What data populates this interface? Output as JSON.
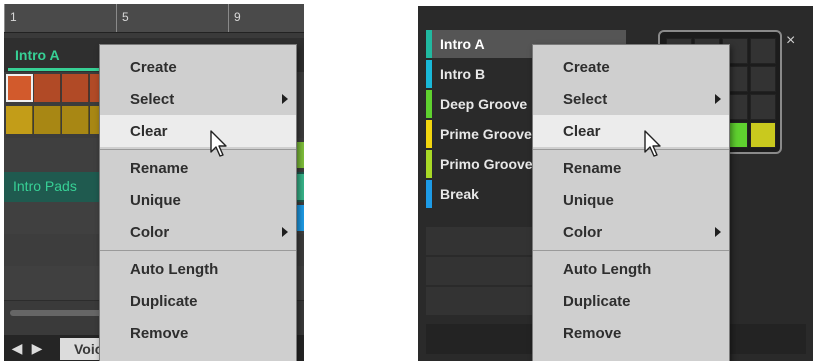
{
  "left": {
    "ruler_bars": [
      "1",
      "5",
      "9"
    ],
    "section_name": "Intro A",
    "pattern_name": "Intro Pads",
    "bottom_tab": "Voice Settings / Engine",
    "menu": {
      "items": [
        "Create",
        "Select",
        "Clear",
        "Rename",
        "Unique",
        "Color",
        "Auto Length",
        "Duplicate",
        "Remove"
      ],
      "submenu_items": [
        "Select",
        "Color"
      ],
      "hovered": "Clear"
    }
  },
  "right": {
    "scenes": [
      {
        "label": "Intro A",
        "color": "#20b9a0"
      },
      {
        "label": "Intro B",
        "color": "#19b8d8"
      },
      {
        "label": "Deep Groove",
        "color": "#5fd12f"
      },
      {
        "label": "Prime Groove",
        "color": "#f2d60f"
      },
      {
        "label": "Primo Groove",
        "color": "#a8d926"
      },
      {
        "label": "Break",
        "color": "#1d9be6"
      }
    ],
    "close_glyph": "×",
    "menu": {
      "items": [
        "Create",
        "Select",
        "Clear",
        "Rename",
        "Unique",
        "Color",
        "Auto Length",
        "Duplicate",
        "Remove"
      ],
      "submenu_items": [
        "Select",
        "Color"
      ],
      "hovered": "Clear"
    }
  },
  "colors": {
    "accent_green": "#37d095",
    "pattern_orange": "#c9542a",
    "pattern_yellow": "#c9a41a",
    "menu_bg": "#cfcfcf",
    "menu_hover": "#ececec"
  },
  "icons": {
    "cursor": "arrow-cursor-icon",
    "close": "close-icon",
    "submenu": "chevron-right-icon",
    "nav_left": "chevron-left-icon",
    "nav_right": "chevron-right-icon"
  }
}
